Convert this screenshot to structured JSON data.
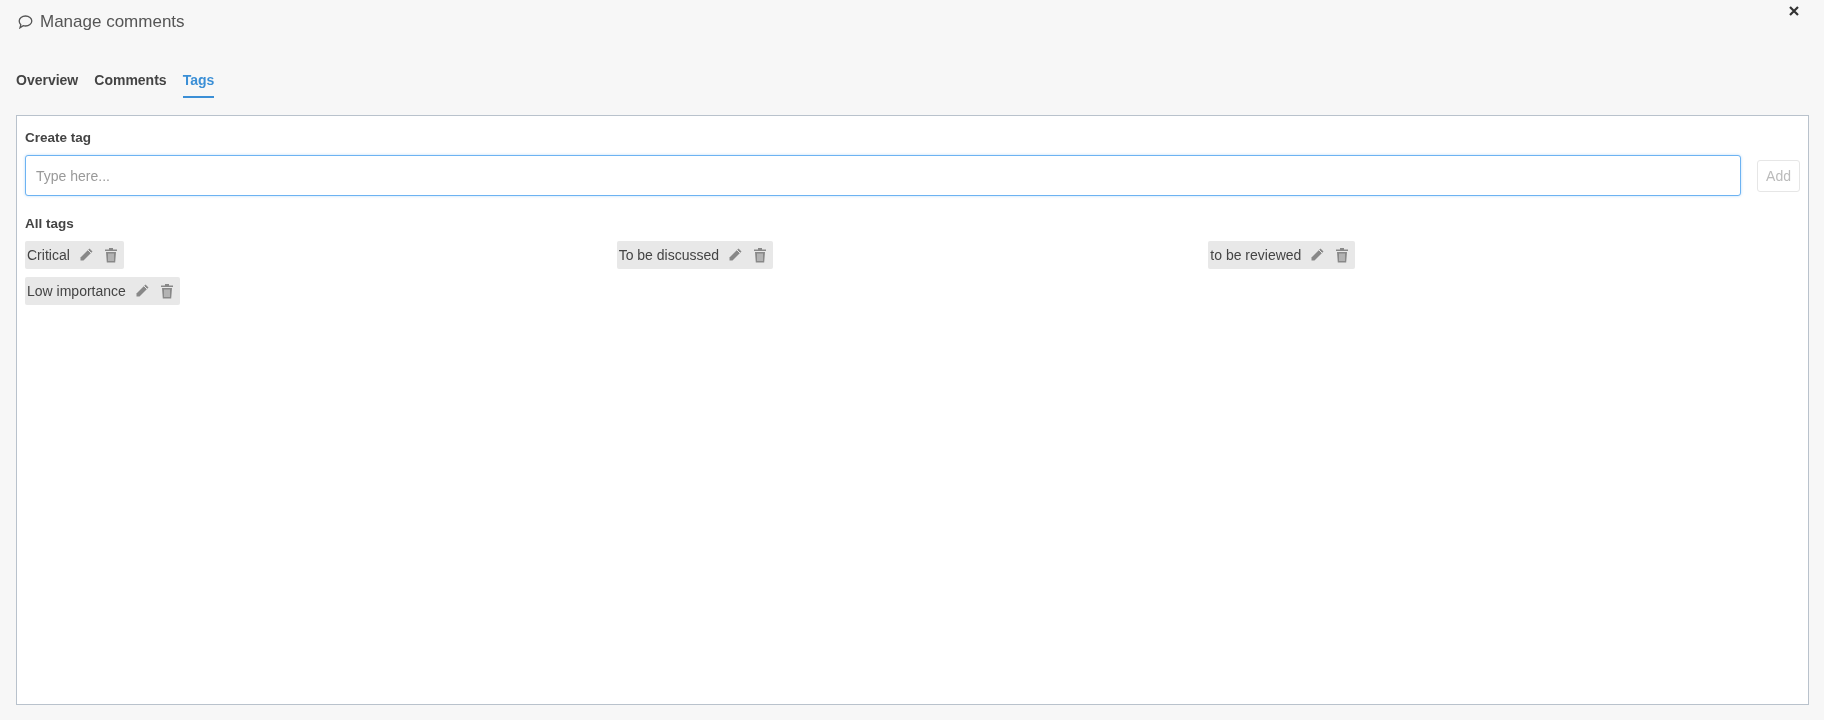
{
  "dialog": {
    "title": "Manage comments"
  },
  "tabs": [
    {
      "label": "Overview",
      "selected": false
    },
    {
      "label": "Comments",
      "selected": false
    },
    {
      "label": "Tags",
      "selected": true
    }
  ],
  "create_tag": {
    "label": "Create tag",
    "placeholder": "Type here...",
    "button": {
      "label": "Add",
      "disabled": true
    }
  },
  "all_tags": {
    "label": "All tags",
    "tags": [
      {
        "name": "Critical"
      },
      {
        "name": "To be discussed"
      },
      {
        "name": "to be reviewed"
      },
      {
        "name": "Low importance"
      }
    ]
  }
}
